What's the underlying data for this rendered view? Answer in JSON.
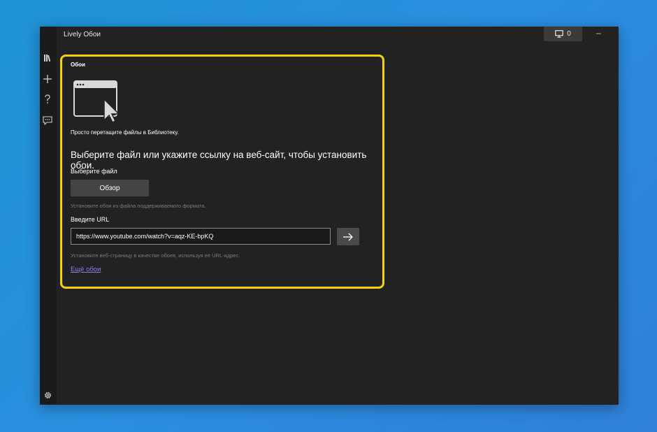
{
  "app": {
    "title": "Lively Обои"
  },
  "titlebar": {
    "screen_count": "0",
    "minimize_symbol": "–"
  },
  "sidebar": {
    "items": [
      {
        "icon": "library-icon"
      },
      {
        "icon": "add-icon"
      },
      {
        "icon": "help-icon"
      },
      {
        "icon": "feedback-icon"
      }
    ],
    "settings_icon": "gear-icon"
  },
  "add_wallpaper": {
    "section_label": "Обои",
    "drop_text": "Просто перетащите файлы в Библиотеку.",
    "heading": "Выберите файл или укажите ссылку на веб-сайт, чтобы установить обои.",
    "file_label": "Выберите файл",
    "browse_label": "Обзор",
    "file_hint": "Установите обои из файла поддерживаемого формата.",
    "url_label": "Введите URL",
    "url_value": "https://www.youtube.com/watch?v=aqz-KE-bpKQ",
    "url_hint": "Установите веб-страницу в качестве обоев, используя её URL-адрес.",
    "more_link": "Ещё обои"
  },
  "colors": {
    "highlight": "#f5d10c",
    "link": "#8d7be6",
    "background": "#222222"
  }
}
